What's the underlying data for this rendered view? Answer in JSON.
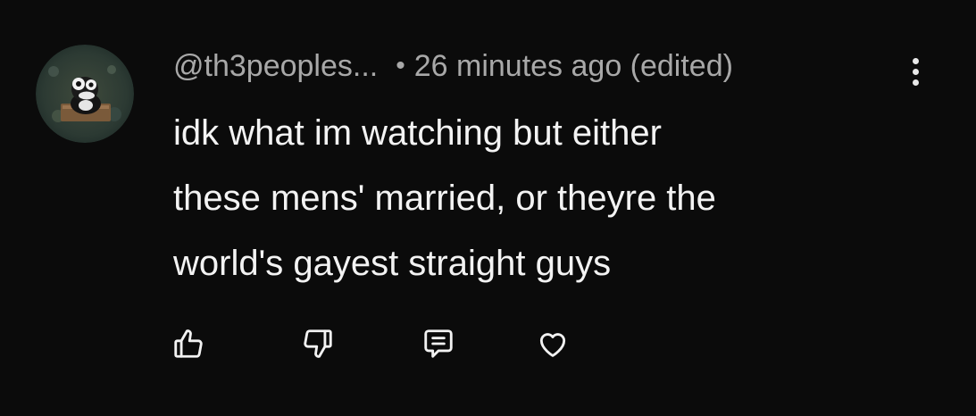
{
  "comment": {
    "author": "@th3peoples...",
    "separator": "•",
    "timestamp": "26 minutes ago (edited)",
    "text_lines": [
      "idk what im watching but either",
      "these mens' married, or theyre the",
      "world's gayest straight guys"
    ],
    "avatar_icon": "duck-avatar-icon",
    "actions": [
      {
        "icon": "thumbs-up-icon"
      },
      {
        "icon": "thumbs-down-icon"
      },
      {
        "icon": "reply-icon"
      },
      {
        "icon": "heart-icon"
      }
    ],
    "menu_icon": "more-vertical-icon"
  },
  "colors": {
    "background": "#0b0b0b",
    "primary_text": "#f3f3f3",
    "secondary_text": "#a8a8a8"
  }
}
